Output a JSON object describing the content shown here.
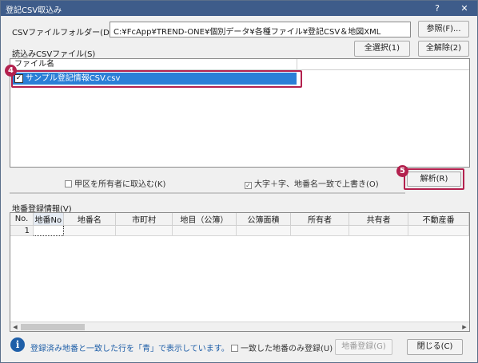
{
  "window": {
    "title": "登記CSV取込み",
    "help_glyph": "?",
    "close_glyph": "✕"
  },
  "folder": {
    "label": "CSVファイルフォルダー(D)",
    "path": "C:¥FcApp¥TREND-ONE¥個別データ¥各種ファイル¥登記CSV＆地図XML",
    "browse_label": "参照(F)..."
  },
  "files": {
    "label": "読込みCSVファイル(S)",
    "select_all_label": "全選択(1)",
    "deselect_all_label": "全解除(2)",
    "column_header": "ファイル名",
    "sort_glyph": "/",
    "items": [
      {
        "name": "サンプル登記情報CSV.csv",
        "checked": "✓"
      }
    ],
    "step_marker": "4"
  },
  "options": {
    "kouku_label": "甲区を所有者に取込む(K)",
    "kouku_checked": "",
    "overwrite_label": "大字＋字、地番名一致で上書き(O)",
    "overwrite_checked": "✓",
    "analyze_label": "解析(R)",
    "step_marker": "5"
  },
  "parcel": {
    "label": "地番登録情報(V)",
    "columns": [
      "No.",
      "地番No",
      "地番名",
      "市町村",
      "地目（公簿）",
      "公簿面積",
      "所有者",
      "共有者",
      "不動産番"
    ],
    "rows": [
      [
        "1",
        "",
        "",
        "",
        "",
        "",
        "",
        "",
        ""
      ]
    ],
    "scroll_left": "◀",
    "scroll_right": "▶"
  },
  "footer": {
    "info_glyph": "i",
    "info_text": "登録済み地番と一致した行を「青」で表示しています。",
    "match_only_label": "一致した地番のみ登録(U)",
    "match_only_checked": "",
    "register_label": "地番登録(G)",
    "close_label": "閉じる(C)"
  },
  "colors": {
    "accent_marker": "#b3214e",
    "selection": "#2b7fd7",
    "titlebar": "#3e5c8a"
  }
}
